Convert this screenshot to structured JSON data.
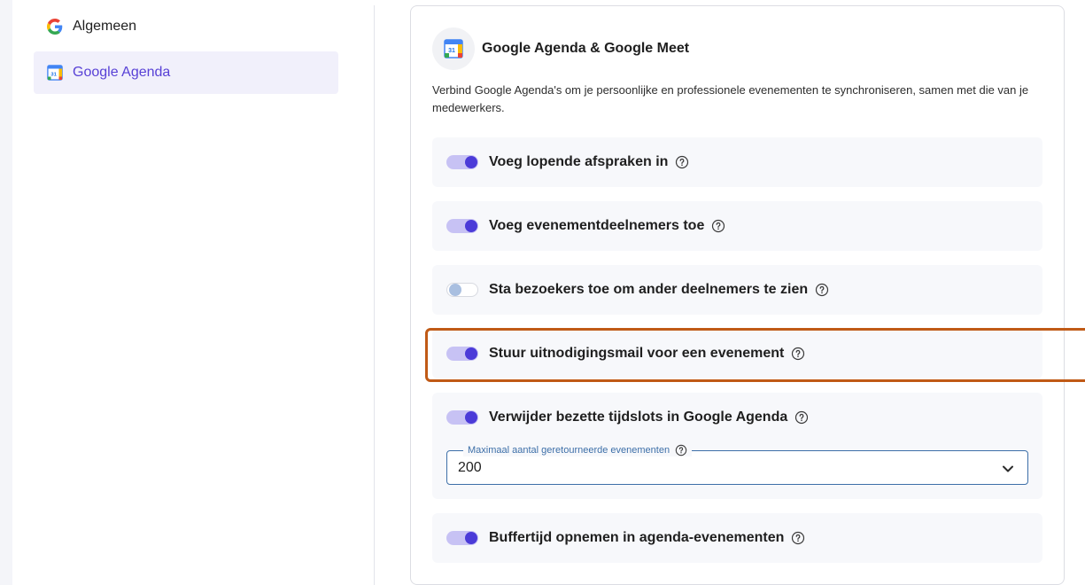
{
  "sidebar": {
    "items": [
      {
        "label": "Algemeen",
        "icon": "google-icon",
        "active": false
      },
      {
        "label": "Google Agenda",
        "icon": "google-calendar-icon",
        "active": true
      }
    ]
  },
  "panel": {
    "title": "Google Agenda & Google Meet",
    "calendar_icon_text": "31",
    "description": "Verbind Google Agenda's om je persoonlijke en professionele evenementen te synchroniseren, samen met die van je medewerkers.",
    "options": [
      {
        "label": "Voeg lopende afspraken in",
        "enabled": true
      },
      {
        "label": "Voeg evenementdeelnemers toe",
        "enabled": true
      },
      {
        "label": "Sta bezoekers toe om ander deelnemers te zien",
        "enabled": false
      },
      {
        "label": "Stuur uitnodigingsmail voor een evenement",
        "enabled": true
      },
      {
        "label": "Verwijder bezette tijdslots in Google Agenda",
        "enabled": true
      },
      {
        "label": "Buffertijd opnemen in agenda-evenementen",
        "enabled": true
      }
    ],
    "max_events_select": {
      "label": "Maximaal aantal geretourneerde evenementen",
      "value": "200"
    }
  },
  "colors": {
    "accent": "#4b3bd8",
    "toggle_track_on": "#c7c2f4",
    "highlight_border": "#c05a16",
    "active_nav_bg": "#f1f0fb",
    "active_nav_text": "#5841d6"
  }
}
